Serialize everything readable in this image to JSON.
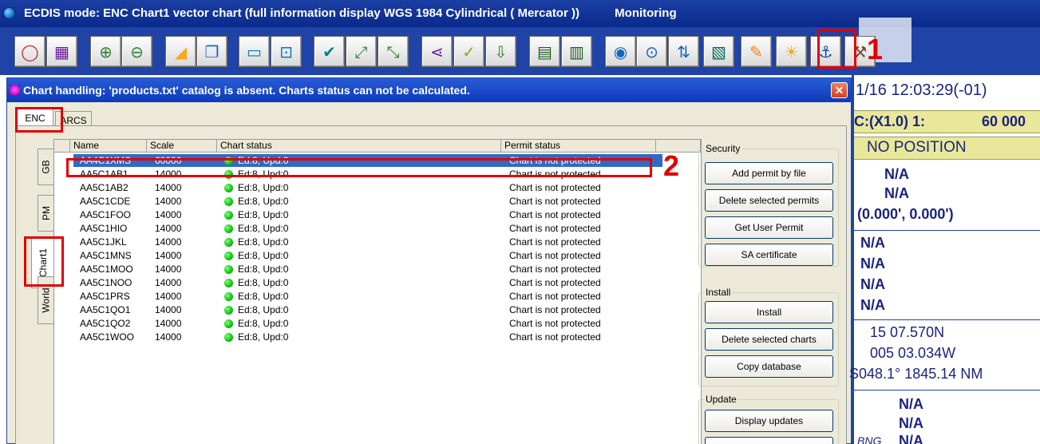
{
  "window": {
    "title": "ECDIS mode: ENC Chart1 vector chart (full information display  WGS 1984  Cylindrical ( Mercator ))",
    "status": "Monitoring"
  },
  "toolbar": {
    "buttons": [
      "lifebuoy-icon",
      "calendar-add-icon",
      "zoom-in-icon",
      "zoom-out-icon",
      "chart-area-icon",
      "layers-icon",
      "chart-frame-icon",
      "chart-fit-icon",
      "ship-check-icon",
      "route-ab-icon",
      "route-ab2-icon",
      "share-nodes-icon",
      "check-route-icon",
      "download-route-icon",
      "chart-add-icon",
      "chart-book-icon",
      "target-icon",
      "target-frame-icon",
      "target-arrows-icon",
      "chart-handling-icon",
      "pencil-icon",
      "sun-icon",
      "anchor-icon",
      "hammer-icon"
    ],
    "marker_label": "1"
  },
  "dialog": {
    "title": "Chart handling:   'products.txt' catalog is absent. Charts status can not be calculated.",
    "close_label": "✕",
    "tabs": [
      "ENC",
      "ARCS"
    ],
    "side_tabs": [
      "GB",
      "PM",
      "Chart1",
      "World"
    ],
    "columns": [
      "Name",
      "Scale",
      "Chart status",
      "Permit status"
    ],
    "marker_label": "2",
    "rows": [
      {
        "name": "AA4C1XMS",
        "scale": "60000",
        "status": "Ed:8, Upd:0",
        "permit": "Chart is not protected"
      },
      {
        "name": "AA5C1AB1",
        "scale": "14000",
        "status": "Ed:8, Upd:0",
        "permit": "Chart is not protected"
      },
      {
        "name": "AA5C1AB2",
        "scale": "14000",
        "status": "Ed:8, Upd:0",
        "permit": "Chart is not protected"
      },
      {
        "name": "AA5C1CDE",
        "scale": "14000",
        "status": "Ed:8, Upd:0",
        "permit": "Chart is not protected"
      },
      {
        "name": "AA5C1FOO",
        "scale": "14000",
        "status": "Ed:8, Upd:0",
        "permit": "Chart is not protected"
      },
      {
        "name": "AA5C1HIO",
        "scale": "14000",
        "status": "Ed:8, Upd:0",
        "permit": "Chart is not protected"
      },
      {
        "name": "AA5C1JKL",
        "scale": "14000",
        "status": "Ed:8, Upd:0",
        "permit": "Chart is not protected"
      },
      {
        "name": "AA5C1MNS",
        "scale": "14000",
        "status": "Ed:8, Upd:0",
        "permit": "Chart is not protected"
      },
      {
        "name": "AA5C1MOO",
        "scale": "14000",
        "status": "Ed:8, Upd:0",
        "permit": "Chart is not protected"
      },
      {
        "name": "AA5C1NOO",
        "scale": "14000",
        "status": "Ed:8, Upd:0",
        "permit": "Chart is not protected"
      },
      {
        "name": "AA5C1PRS",
        "scale": "14000",
        "status": "Ed:8, Upd:0",
        "permit": "Chart is not protected"
      },
      {
        "name": "AA5C1QO1",
        "scale": "14000",
        "status": "Ed:8, Upd:0",
        "permit": "Chart is not protected"
      },
      {
        "name": "AA5C1QO2",
        "scale": "14000",
        "status": "Ed:8, Upd:0",
        "permit": "Chart is not protected"
      },
      {
        "name": "AA5C1WOO",
        "scale": "14000",
        "status": "Ed:8, Upd:0",
        "permit": "Chart is not protected"
      }
    ],
    "groups": {
      "security": {
        "label": "Security",
        "buttons": [
          "Add permit by file",
          "Delete selected permits",
          "Get User Permit",
          "SA certificate"
        ]
      },
      "install": {
        "label": "Install",
        "buttons": [
          "Install",
          "Delete selected charts",
          "Copy database"
        ]
      },
      "update": {
        "label": "Update",
        "buttons": [
          "Display updates"
        ]
      }
    }
  },
  "info_panel": {
    "datetime": "1/16 12:03:29(-01)",
    "scale_prefix": "C:(X1.0) 1:",
    "scale_value": "60 000",
    "position": "NO POSITION",
    "na1": "N/A",
    "na2": "N/A",
    "offset": "(0.000', 0.000')",
    "na3": "N/A",
    "na4": "N/A",
    "na5": "N/A",
    "na6": "N/A",
    "lat": "15 07.570N",
    "lon": "005 03.034W",
    "bearing": "S048.1° 1845.14 NM",
    "na7": "N/A",
    "na8": "N/A",
    "na9_prefix": "BNG",
    "na9": "N/A"
  },
  "colors": {
    "title_bar": "#0a2a8c",
    "toolbar": "#1f43a6",
    "selection": "#316ac5",
    "annotation": "#e00000",
    "info_yellow": "#e9e89a"
  }
}
